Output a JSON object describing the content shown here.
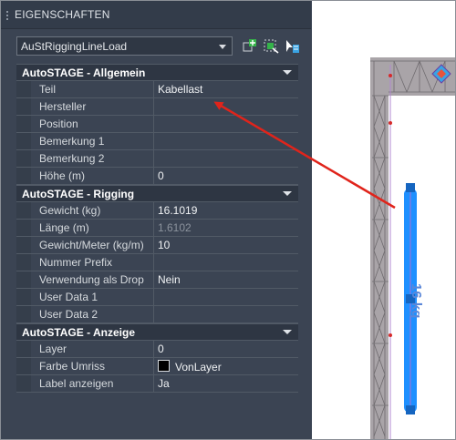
{
  "palette": {
    "title": "EIGENSCHAFTEN",
    "object_type": "AuStRiggingLineLoad",
    "toolbar_icons": [
      "quick-select-icon",
      "select-objects-icon",
      "toggle-pickadd-icon"
    ]
  },
  "sections": [
    {
      "title": "AutoSTAGE - Allgemein",
      "rows": [
        {
          "label": "Teil",
          "value": "Kabellast"
        },
        {
          "label": "Hersteller",
          "value": ""
        },
        {
          "label": "Position",
          "value": ""
        },
        {
          "label": "Bemerkung 1",
          "value": ""
        },
        {
          "label": "Bemerkung 2",
          "value": ""
        },
        {
          "label": "Höhe (m)",
          "value": "0"
        }
      ]
    },
    {
      "title": "AutoSTAGE - Rigging",
      "rows": [
        {
          "label": "Gewicht (kg)",
          "value": "16.1019"
        },
        {
          "label": "Länge (m)",
          "value": "1.6102",
          "readonly": true
        },
        {
          "label": "Gewicht/Meter (kg/m)",
          "value": "10"
        },
        {
          "label": "Nummer Prefix",
          "value": ""
        },
        {
          "label": "Verwendung als Drop",
          "value": "Nein"
        },
        {
          "label": "User Data 1",
          "value": ""
        },
        {
          "label": "User Data 2",
          "value": ""
        }
      ]
    },
    {
      "title": "AutoSTAGE - Anzeige",
      "rows": [
        {
          "label": "Layer",
          "value": "0"
        },
        {
          "label": "Farbe Umriss",
          "value": "VonLayer",
          "swatch": "#000000"
        },
        {
          "label": "Label anzeigen",
          "value": "Ja"
        }
      ]
    }
  ],
  "viewport": {
    "load_label": "16 kg",
    "colors": {
      "load_line": "#1e90ff",
      "truss": "#a9a4a8",
      "annotation_arrow": "#e0241b",
      "node_marker": "#d62a2a"
    }
  }
}
